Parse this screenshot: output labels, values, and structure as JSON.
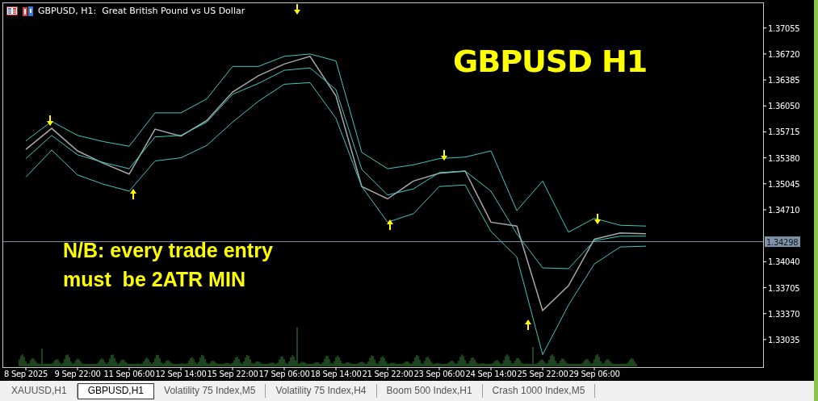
{
  "chart_window": {
    "title": "GBPUSD, H1:  Great British Pound vs US Dollar",
    "heading": "GBPUSD H1",
    "note": "N/B: every trade entry\nmust  be 2ATR MIN",
    "chart_data": {
      "type": "line",
      "categories": [
        "8 Sep 2025",
        null,
        "9 Sep 22:00",
        null,
        "11 Sep 06:00",
        null,
        "12 Sep 14:00",
        null,
        "15 Sep 22:00",
        null,
        "17 Sep 06:00",
        null,
        "18 Sep 14:00",
        null,
        "21 Sep 22:00",
        null,
        "23 Sep 06:00",
        null,
        "24 Sep 14:00",
        null,
        "25 Sep 22:00",
        null,
        "29 Sep 06:00",
        null,
        null
      ],
      "series": [
        {
          "color": "#a8a8a8",
          "values": [
            1.3549,
            1.3576,
            1.3547,
            1.3531,
            1.3517,
            1.3575,
            1.3566,
            1.3586,
            1.3623,
            1.3644,
            1.3659,
            1.3669,
            1.3618,
            1.3501,
            1.3485,
            1.3508,
            1.3518,
            1.3521,
            1.3455,
            1.345,
            1.3341,
            1.3373,
            1.3433,
            1.3441,
            1.344
          ]
        },
        {
          "color": "#3fc8c0",
          "values": [
            1.356,
            1.3585,
            1.3567,
            1.3559,
            1.3553,
            1.3596,
            1.3596,
            1.3614,
            1.3656,
            1.3656,
            1.3669,
            1.3672,
            1.3663,
            1.3545,
            1.3524,
            1.3529,
            1.3537,
            1.3539,
            1.3547,
            1.347,
            1.3508,
            1.3442,
            1.346,
            1.3451,
            1.345
          ]
        },
        {
          "color": "#3fc8c0",
          "values": [
            1.3537,
            1.3567,
            1.3542,
            1.3532,
            1.3524,
            1.3565,
            1.3567,
            1.3584,
            1.362,
            1.3634,
            1.3651,
            1.3654,
            1.3626,
            1.3523,
            1.349,
            1.3498,
            1.3519,
            1.3521,
            1.3495,
            1.344,
            1.3396,
            1.3395,
            1.3431,
            1.3437,
            1.3437
          ]
        },
        {
          "color": "#3fc8c0",
          "values": [
            1.3513,
            1.3548,
            1.3516,
            1.3504,
            1.3495,
            1.3534,
            1.3538,
            1.3554,
            1.3584,
            1.3611,
            1.3633,
            1.3635,
            1.3589,
            1.3501,
            1.3455,
            1.3466,
            1.3501,
            1.3503,
            1.3443,
            1.341,
            1.3284,
            1.3348,
            1.3401,
            1.3423,
            1.3424
          ]
        }
      ],
      "ylim": [
        1.3268,
        1.3738
      ],
      "yticks": [
        {
          "value": 1.37055,
          "label": "1.37055"
        },
        {
          "value": 1.3672,
          "label": "1.36720"
        },
        {
          "value": 1.36385,
          "label": "1.36385"
        },
        {
          "value": 1.3605,
          "label": "1.36050"
        },
        {
          "value": 1.35715,
          "label": "1.35715"
        },
        {
          "value": 1.3538,
          "label": "1.35380"
        },
        {
          "value": 1.35045,
          "label": "1.35045"
        },
        {
          "value": 1.3471,
          "label": "1.34710"
        },
        {
          "value": 1.3404,
          "label": "1.34040"
        },
        {
          "value": 1.33705,
          "label": "1.33705"
        },
        {
          "value": 1.3337,
          "label": "1.33370"
        },
        {
          "value": 1.33035,
          "label": "1.33035"
        }
      ],
      "ref_lines": [
        {
          "axis": "y",
          "value": 1.34298,
          "label": "1.34298"
        }
      ]
    }
  },
  "tabs": [
    {
      "label": "XAUUSD,H1",
      "selected": false
    },
    {
      "label": "GBPUSD,H1",
      "selected": true
    },
    {
      "label": "Volatility 75 Index,M5",
      "selected": false
    },
    {
      "label": "Volatility 75 Index,H4",
      "selected": false
    },
    {
      "label": "Boom 500 Index,H1",
      "selected": false
    },
    {
      "label": "Crash 1000 Index,M5",
      "selected": false
    }
  ]
}
